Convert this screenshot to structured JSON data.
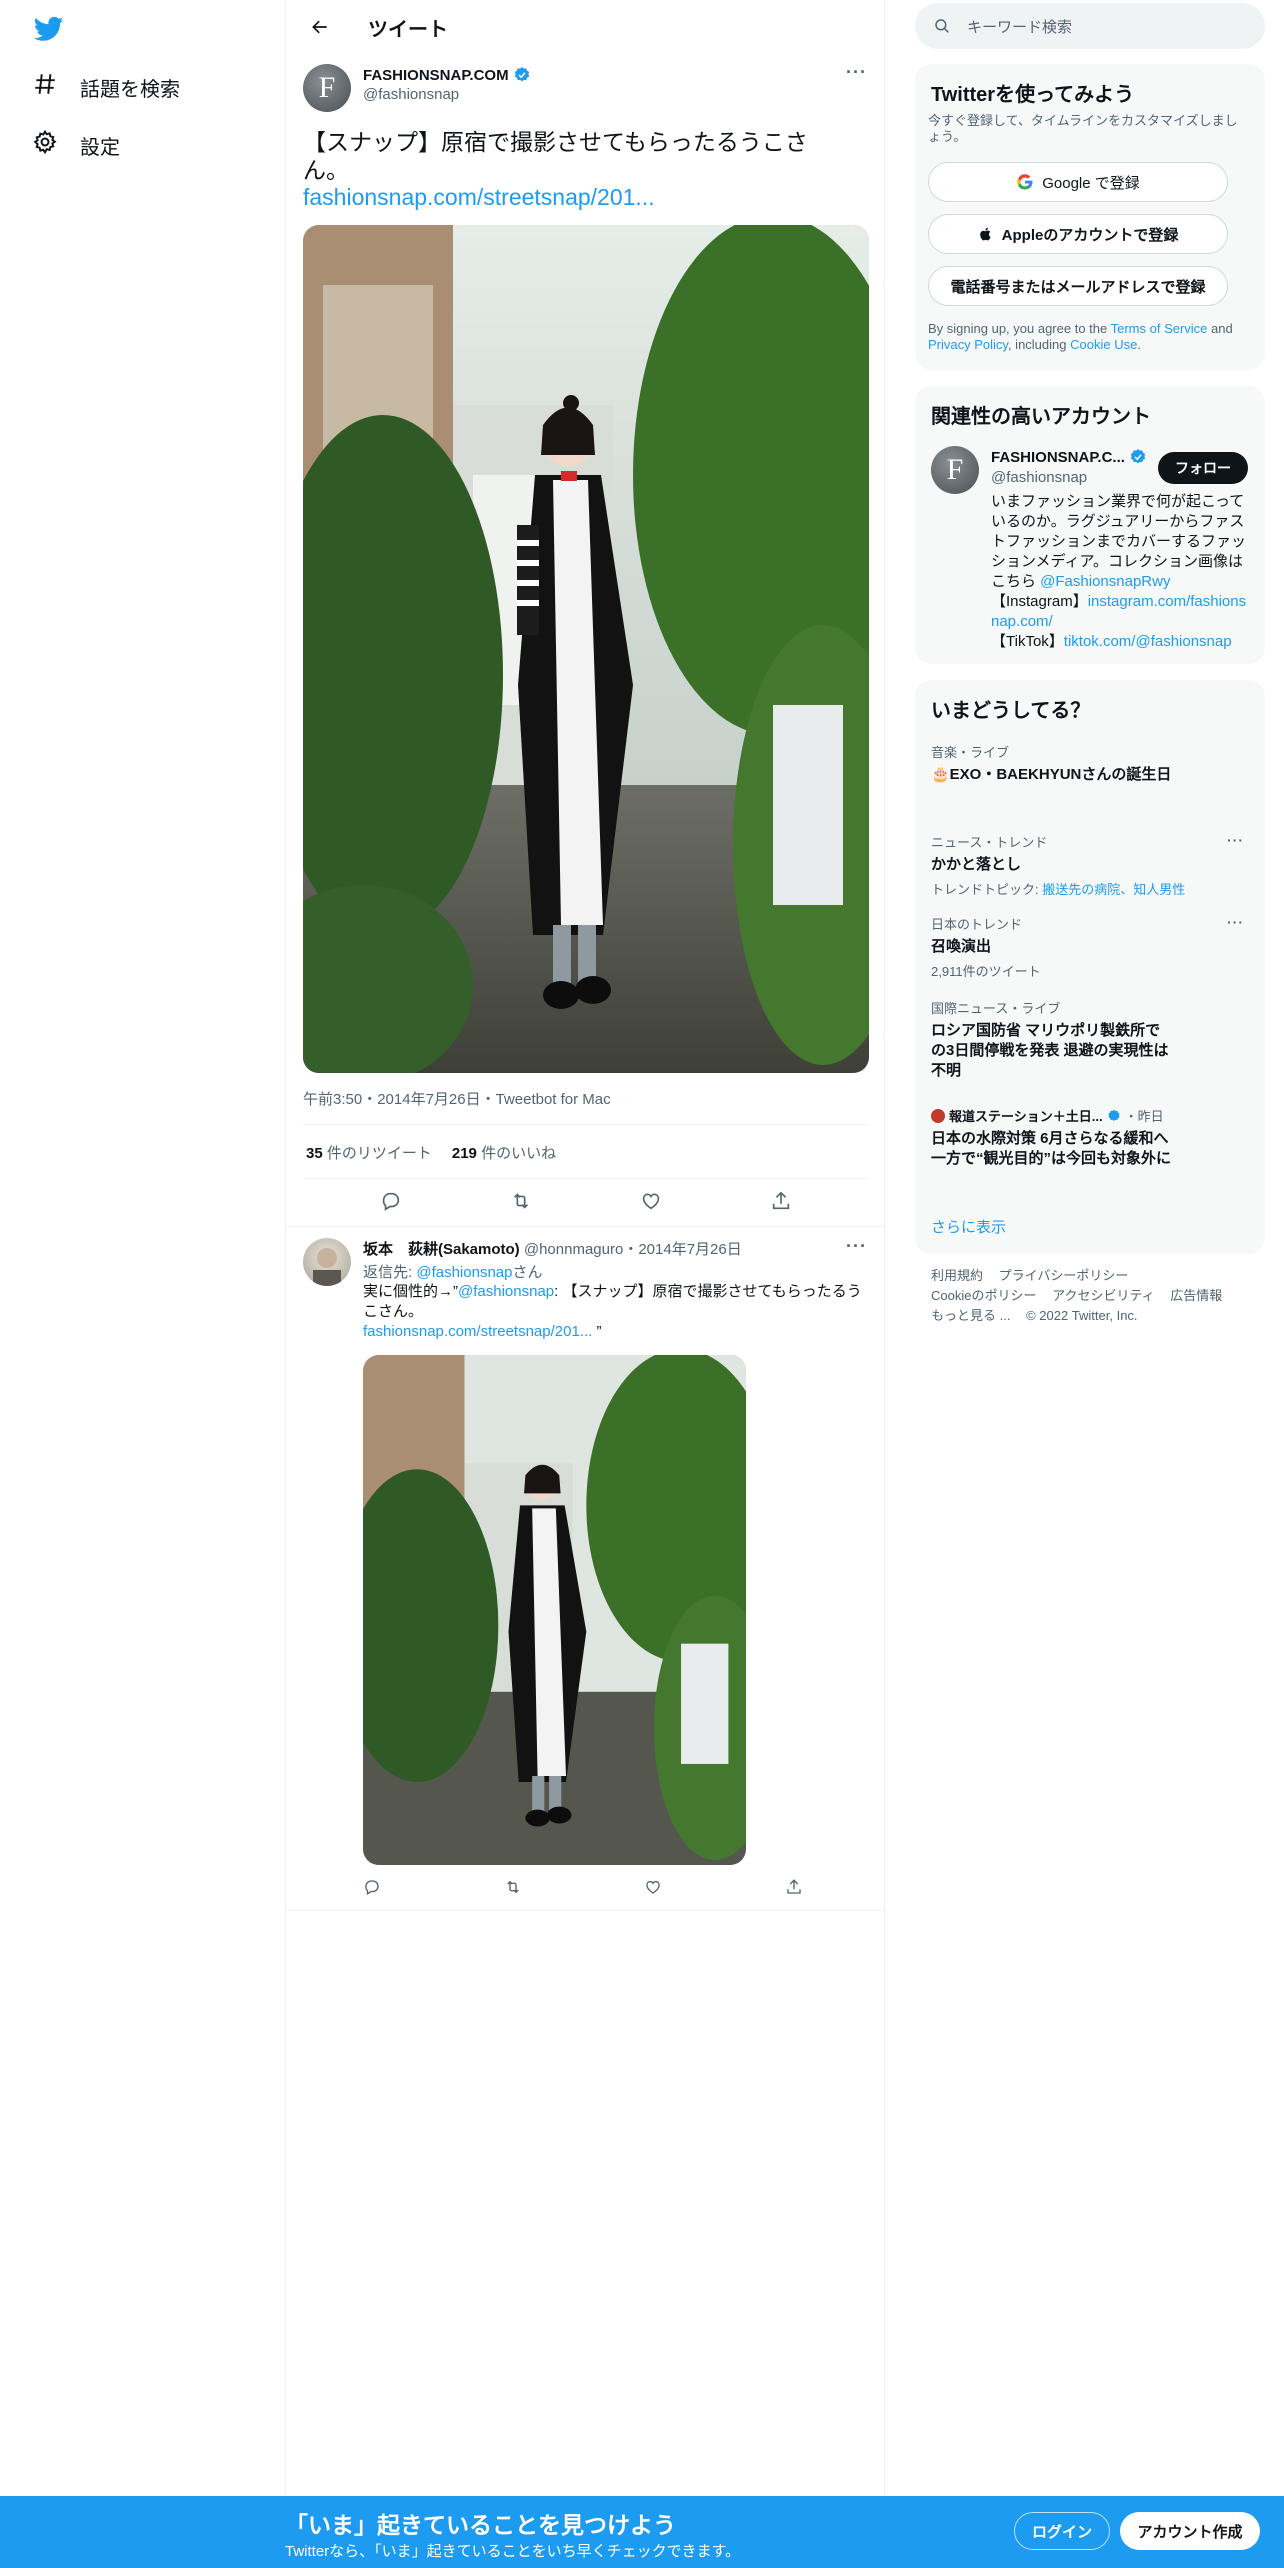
{
  "nav": {
    "explore_label": "話題を検索",
    "settings_label": "設定"
  },
  "header": {
    "title": "ツイート"
  },
  "tweet": {
    "avatar_letter": "F",
    "name": "FASHIONSNAP.COM",
    "handle": "@fashionsnap",
    "text": "【スナップ】原宿で撮影させてもらったるうこさん。",
    "link": "fashionsnap.com/streetsnap/201...",
    "meta": "午前3:50・2014年7月26日・Tweetbot for Mac",
    "retweet_count": "35",
    "retweet_label": "件のリツイート",
    "like_count": "219",
    "like_label": "件のいいね"
  },
  "reply": {
    "name": "坂本　荻耕(Sakamoto)",
    "handle": "@honnmaguro",
    "date": "・2014年7月26日",
    "reply_to_label": "返信先: ",
    "reply_to_handle": "@fashionsnap",
    "reply_to_suffix": "さん",
    "text_prefix": "実に個性的→”",
    "mention": "@fashionsnap",
    "text_suffix": ": 【スナップ】原宿で撮影させてもらったるうこさん。",
    "link": "fashionsnap.com/streetsnap/201...",
    "quote_end": " ”"
  },
  "search": {
    "placeholder": "キーワード検索"
  },
  "signup": {
    "title": "Twitterを使ってみよう",
    "subtitle": "今すぐ登録して、タイムラインをカスタマイズしましょう。",
    "google_label": "Google で登録",
    "apple_label": "Appleのアカウントで登録",
    "phone_label": "電話番号またはメールアドレスで登録",
    "terms_prefix": "By signing up, you agree to the ",
    "terms_link": "Terms of Service",
    "terms_and": " and ",
    "privacy_link": "Privacy Policy",
    "terms_including": ", including ",
    "cookie_link": "Cookie Use",
    "terms_end": "."
  },
  "related": {
    "title": "関連性の高いアカウント",
    "name": "FASHIONSNAP.C...",
    "handle": "@fashionsnap",
    "follow_label": "フォロー",
    "bio_line": "いまファッション業界で何が起こっているのか。ラグジュアリーからファストファッションまでカバーするファッションメディア。コレクション画像はこちら ",
    "bio_mention": "@FashionsnapRwy",
    "bio_ig_label": "【Instagram】",
    "bio_ig_link": "instagram.com/fashionsnap.com/",
    "bio_tt_label": "【TikTok】",
    "bio_tt_link": "tiktok.com/@fashionsnap"
  },
  "trends": {
    "title": "いまどうしてる？",
    "items": [
      {
        "category": "音楽・ライブ",
        "title": "🎂EXO・BAEKHYUNさんの誕生日"
      },
      {
        "category": "ニュース・トレンド",
        "title": "かかと落とし",
        "sub_label": "トレンドトピック: ",
        "sub_link": "搬送先の病院、知人男性"
      },
      {
        "category": "日本のトレンド",
        "title": "召喚演出",
        "count": "2,911件のツイート"
      },
      {
        "category": "国際ニュース・ライブ",
        "title": "ロシア国防省 マリウポリ製鉄所での3日間停戦を発表 退避の実現性は不明"
      },
      {
        "category": "報道ステーション＋土日...",
        "time": "・昨日",
        "title": "日本の水際対策 6月さらなる緩和へ　一方で“観光目的”は今回も対象外に"
      }
    ],
    "show_more": "さらに表示"
  },
  "footer": {
    "links": [
      "利用規約",
      "プライバシーポリシー",
      "Cookieのポリシー",
      "アクセシビリティ",
      "広告情報",
      "もっと見る ..."
    ],
    "copyright": "© 2022 Twitter, Inc."
  },
  "bottombar": {
    "title": "「いま」起きていることを見つけよう",
    "subtitle": "Twitterなら、「いま」起きていることをいち早くチェックできます。",
    "login_label": "ログイン",
    "signup_label": "アカウント作成"
  },
  "colors": {
    "accent": "#1d9bf0",
    "text": "#0f1419",
    "secondary": "#536471"
  }
}
